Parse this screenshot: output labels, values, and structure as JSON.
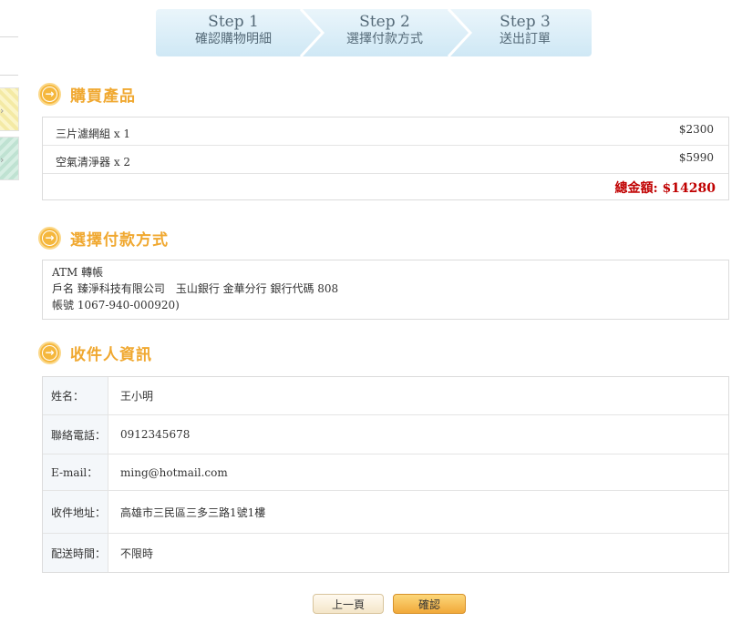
{
  "steps": [
    {
      "num": "Step 1",
      "label": "確認購物明細"
    },
    {
      "num": "Step 2",
      "label": "選擇付款方式"
    },
    {
      "num": "Step 3",
      "label": "送出訂單"
    }
  ],
  "products": {
    "title": "購買產品",
    "items": [
      {
        "name": "三片濾網組 x 1",
        "price": "$2300"
      },
      {
        "name": "空氣清淨器 x 2",
        "price": "$5990"
      }
    ],
    "total": "總金額: $14280"
  },
  "payment": {
    "title": "選擇付款方式",
    "lines": [
      "ATM 轉帳",
      "戶名 臻淨科技有限公司　玉山銀行 金華分行 銀行代碼 808",
      "帳號 1067-940-000920)"
    ]
  },
  "recipient": {
    "title": "收件人資訊",
    "rows": [
      {
        "label": "姓名：",
        "value": "王小明"
      },
      {
        "label": "聯絡電話：",
        "value": "0912345678"
      },
      {
        "label": "E-mail：",
        "value": "ming@hotmail.com"
      },
      {
        "label": "收件地址：",
        "value": "高雄市三民區三多三路1號1樓"
      },
      {
        "label": "配送時間：",
        "value": "不限時"
      }
    ]
  },
  "buttons": {
    "prev": "上一頁",
    "confirm": "確認"
  },
  "icons": {
    "section": "arrow-right-circle-icon",
    "thumb_arrow": "chevron-right-icon"
  },
  "colors": {
    "accent": "#f0a830",
    "total": "#c00000",
    "stepbar": "#cfe8f5"
  }
}
